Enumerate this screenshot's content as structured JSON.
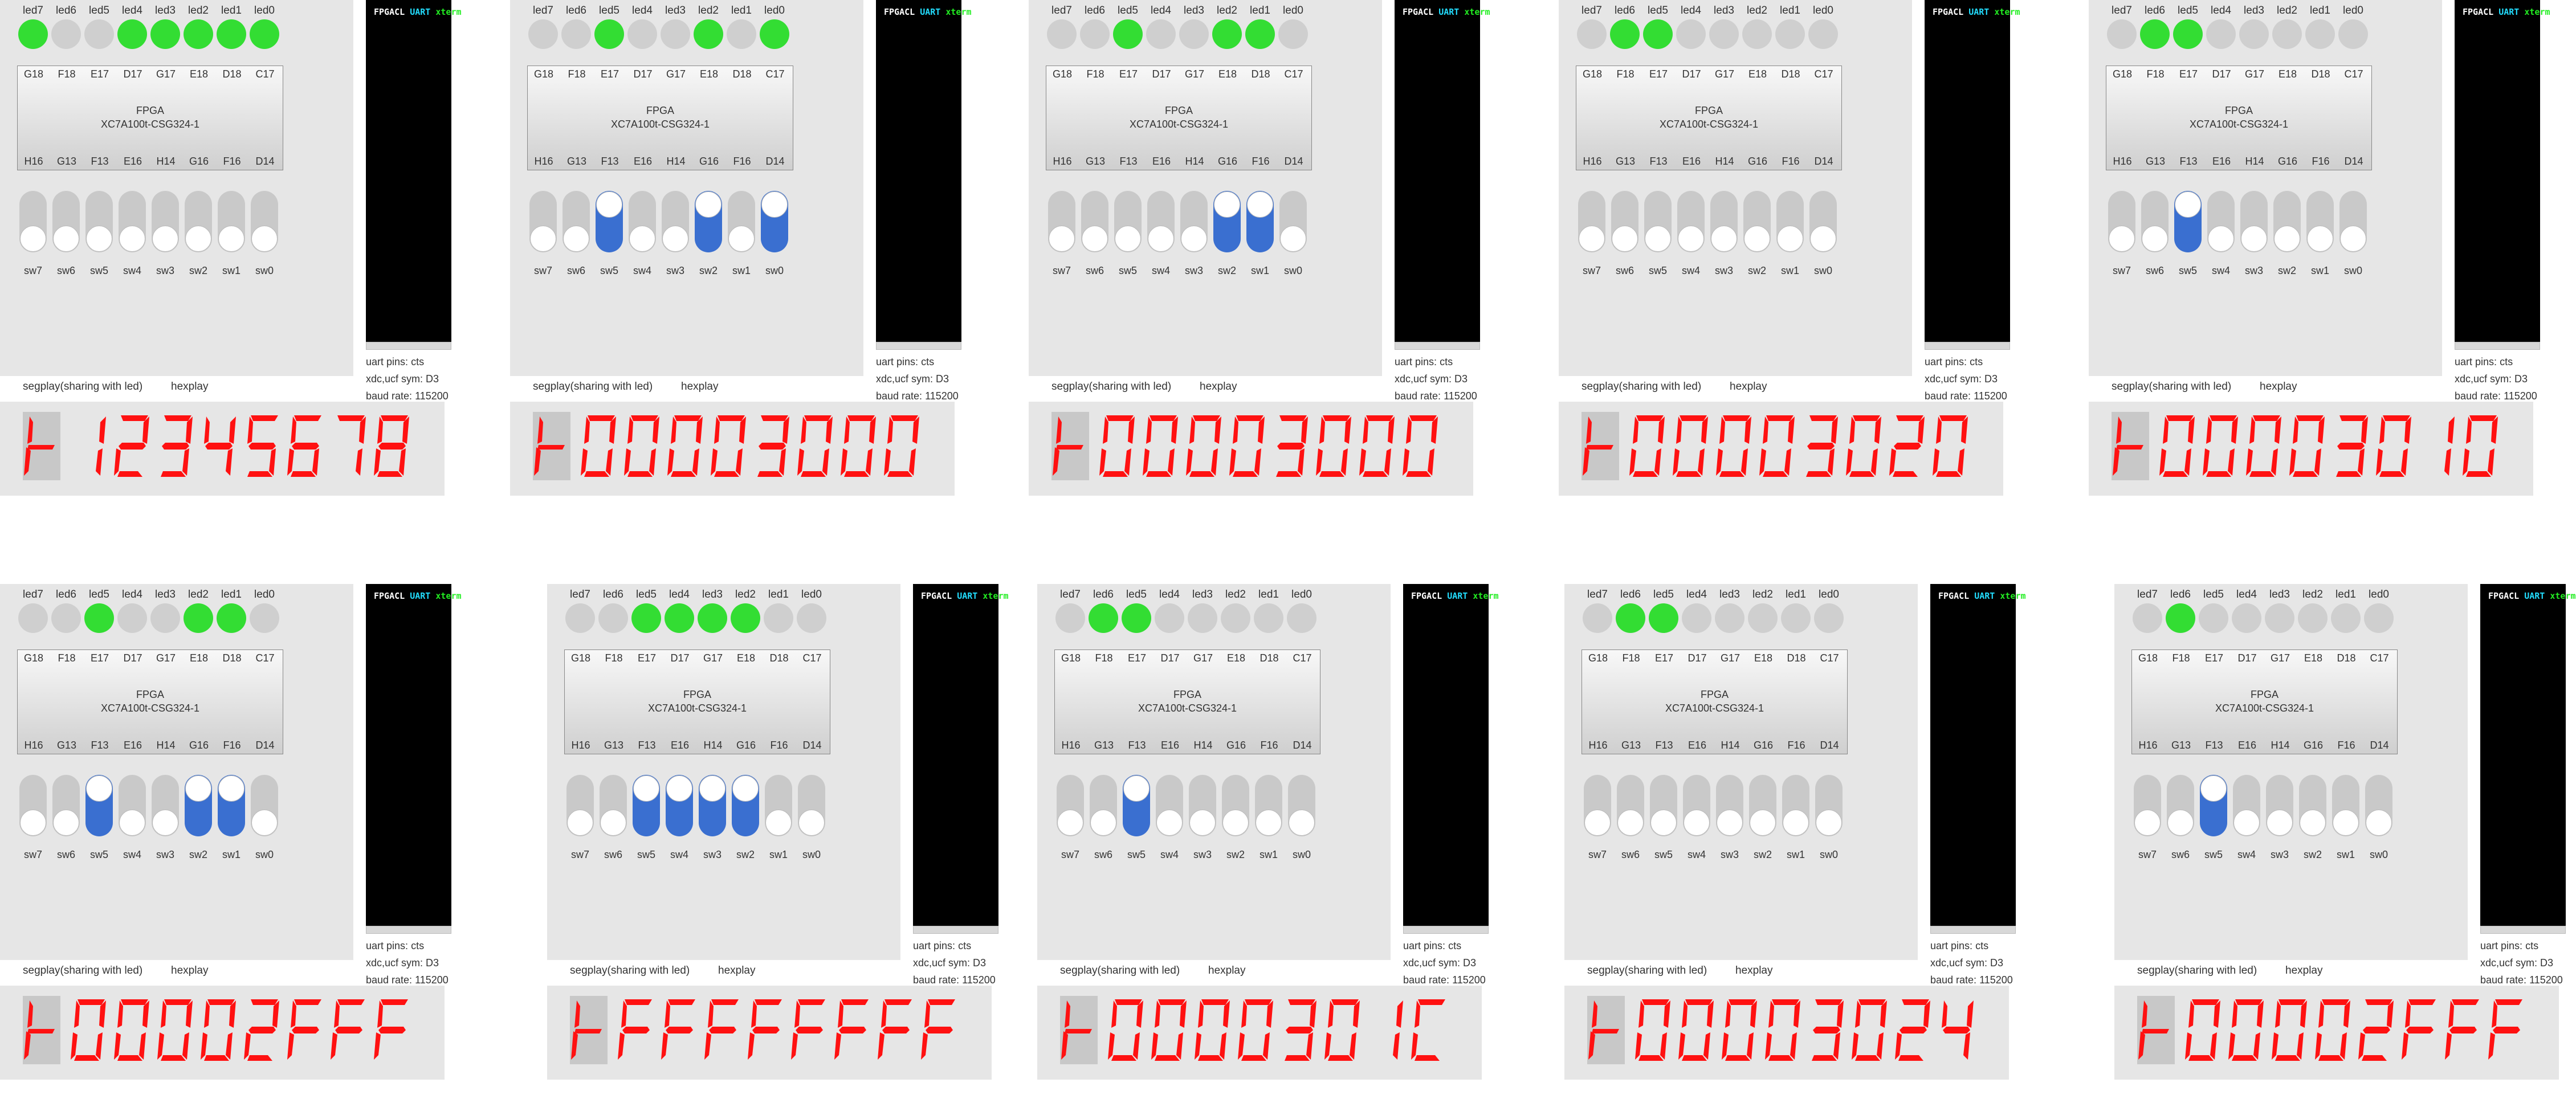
{
  "window": {
    "title": "FPGA board simulator - led / switch / segment display / uart"
  },
  "common": {
    "led_labels": [
      "led7",
      "led6",
      "led5",
      "led4",
      "led3",
      "led2",
      "led1",
      "led0"
    ],
    "led_pins": [
      "G18",
      "F18",
      "E17",
      "D17",
      "G17",
      "E18",
      "D18",
      "C17"
    ],
    "switch_pins": [
      "H16",
      "G13",
      "F13",
      "E16",
      "H14",
      "G16",
      "F16",
      "D14"
    ],
    "switch_labels": [
      "sw7",
      "sw6",
      "sw5",
      "sw4",
      "sw3",
      "sw2",
      "sw1",
      "sw0"
    ],
    "chip_name": "FPGA",
    "chip_part": "XC7A100t-CSG324-1",
    "seg_label": "segplay(sharing with led)",
    "seg_tab": "hexplay",
    "uart_pins_label": "uart pins:",
    "uart_pins_value": "cts",
    "xdc_label": "xdc,ucf sym:",
    "xdc_value": "D3",
    "baud_label": "baud rate:",
    "baud_value": "115200",
    "uart_title_a": "FPGACL",
    "uart_title_b": "UART",
    "uart_title_c": "xterm",
    "seg_color": "#ff1111",
    "led_on_color": "#33dd33",
    "switch_on_color": "#3a6fd0"
  },
  "panels": [
    {
      "leds": [
        1,
        0,
        0,
        1,
        1,
        1,
        1,
        1
      ],
      "switches": [
        0,
        0,
        0,
        0,
        0,
        0,
        0,
        0
      ],
      "display": "0.12345678"
    },
    {
      "leds": [
        0,
        0,
        1,
        0,
        0,
        1,
        0,
        1
      ],
      "switches": [
        0,
        0,
        1,
        0,
        0,
        1,
        0,
        1
      ],
      "display": "00003000"
    },
    {
      "leds": [
        0,
        0,
        1,
        0,
        0,
        1,
        1,
        0
      ],
      "switches": [
        0,
        0,
        0,
        0,
        0,
        1,
        1,
        0
      ],
      "display": "00003000"
    },
    {
      "leds": [
        0,
        1,
        1,
        0,
        0,
        0,
        0,
        0
      ],
      "switches": [
        0,
        0,
        0,
        0,
        0,
        0,
        0,
        0
      ],
      "display": "00003020"
    },
    {
      "leds": [
        0,
        1,
        1,
        0,
        0,
        0,
        0,
        0
      ],
      "switches": [
        0,
        0,
        1,
        0,
        0,
        0,
        0,
        0
      ],
      "display": "00003010"
    },
    {
      "leds": [
        0,
        0,
        1,
        0,
        0,
        1,
        1,
        0
      ],
      "switches": [
        0,
        0,
        1,
        0,
        0,
        1,
        1,
        0
      ],
      "display": "00002FFF"
    },
    {
      "leds": [
        0,
        0,
        1,
        1,
        1,
        1,
        0,
        0
      ],
      "switches": [
        0,
        0,
        1,
        1,
        1,
        1,
        0,
        0
      ],
      "display": "FFFFFFFF"
    },
    {
      "leds": [
        0,
        1,
        1,
        0,
        0,
        0,
        0,
        0
      ],
      "switches": [
        0,
        0,
        1,
        0,
        0,
        0,
        0,
        0
      ],
      "display": "0000301C"
    },
    {
      "leds": [
        0,
        1,
        1,
        0,
        0,
        0,
        0,
        0
      ],
      "switches": [
        0,
        0,
        0,
        0,
        0,
        0,
        0,
        0
      ],
      "display": "00003024"
    },
    {
      "leds": [
        0,
        1,
        0,
        0,
        0,
        0,
        0,
        0
      ],
      "switches": [
        0,
        0,
        1,
        0,
        0,
        0,
        0,
        0
      ],
      "display": "00002FFF"
    }
  ]
}
